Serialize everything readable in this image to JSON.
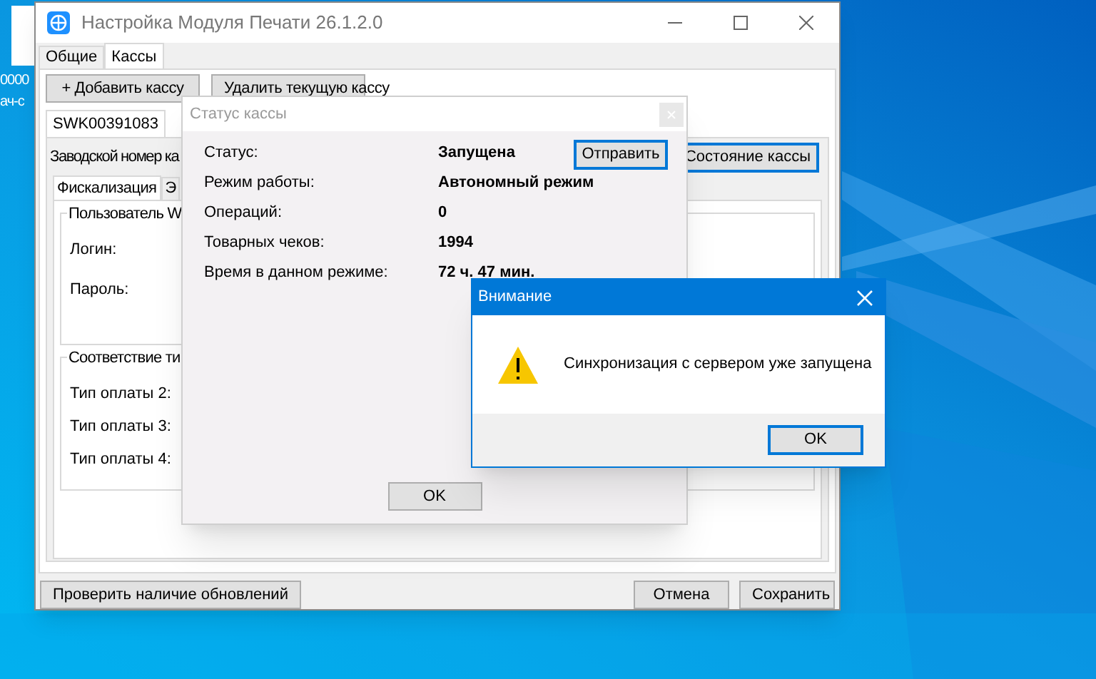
{
  "desktop": {
    "icon_labels": [
      "0000",
      "ач-с"
    ]
  },
  "main_window": {
    "title": "Настройка Модуля Печати 26.1.2.0",
    "tabs": [
      {
        "label": "Общие",
        "selected": false
      },
      {
        "label": "Кассы",
        "selected": true
      }
    ],
    "toolbar_buttons": [
      {
        "label": "+ Добавить кассу",
        "focused": false
      },
      {
        "label": "Удалить текущую кассу",
        "focused": false
      }
    ],
    "register_tabs": [
      {
        "label": "SWK00391083",
        "selected": true
      }
    ],
    "serial_label": "Заводской номер ка",
    "status_button": {
      "label": "Состояние кассы",
      "focused": true
    },
    "sub_tabs": [
      {
        "label": "Фискализация",
        "selected": true
      },
      {
        "label": "Э",
        "selected": false
      }
    ],
    "groups": [
      {
        "title": "Пользователь W",
        "fields": [
          "Логин:",
          "Пароль:"
        ]
      },
      {
        "title": "Соответствие ти",
        "fields": [
          "Тип оплаты 2:",
          "Тип оплаты 3:",
          "Тип оплаты 4:"
        ]
      }
    ],
    "footer_buttons": [
      {
        "label": "Проверить наличие обновлений",
        "focused": false
      },
      {
        "label": "Отмена",
        "focused": false
      },
      {
        "label": "Сохранить",
        "focused": false
      }
    ]
  },
  "status_dialog": {
    "title": "Статус кассы",
    "rows": [
      {
        "label": "Статус:",
        "value": "Запущена"
      },
      {
        "label": "Режим работы:",
        "value": "Автономный режим"
      },
      {
        "label": "Операций:",
        "value": "0"
      },
      {
        "label": "Товарных чеков:",
        "value": "1994"
      },
      {
        "label": "Время в данном режиме:",
        "value": "72 ч. 47 мин."
      }
    ],
    "send_button": {
      "label": "Отправить",
      "focused": true
    },
    "ok_button": {
      "label": "OK",
      "focused": false
    }
  },
  "alert": {
    "title": "Внимание",
    "message": "Синхронизация с сервером уже запущена",
    "ok_button": {
      "label": "OK",
      "focused": true
    }
  }
}
